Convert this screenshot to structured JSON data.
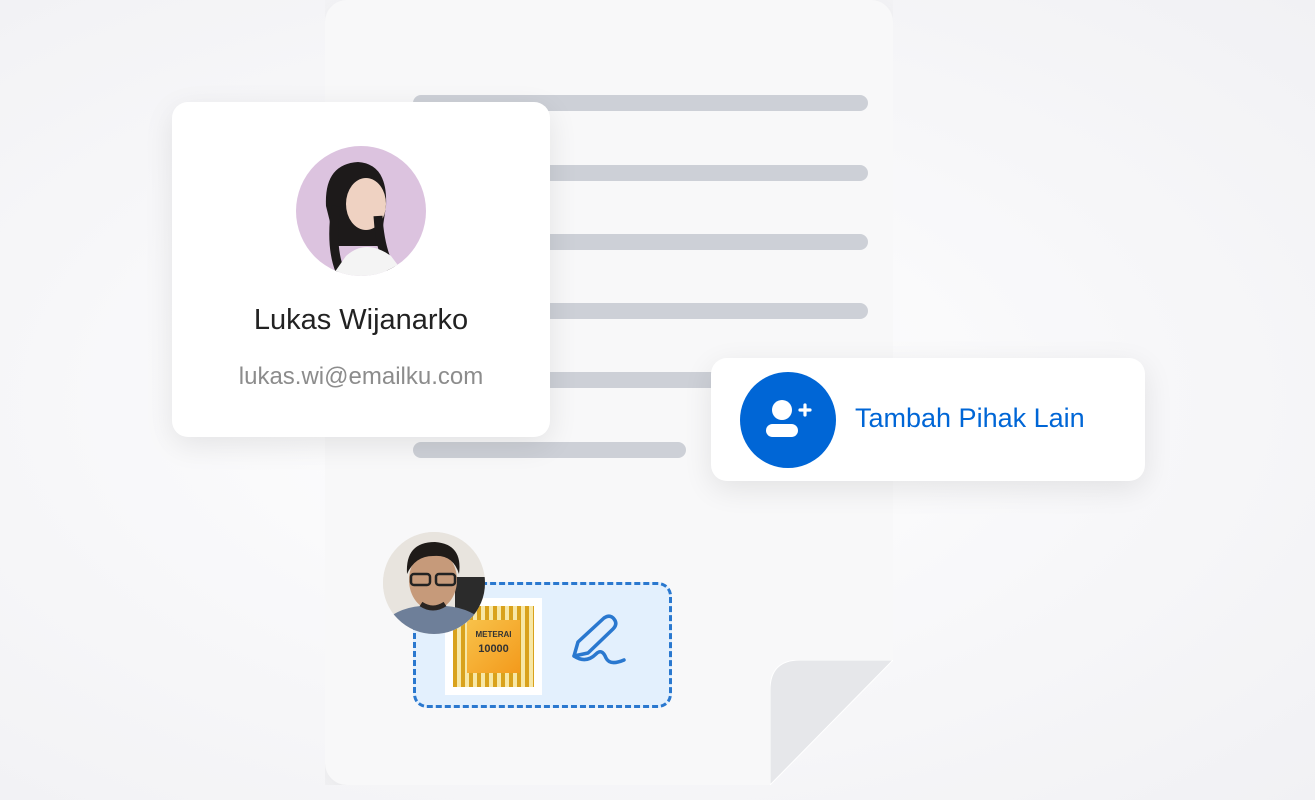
{
  "signer": {
    "name": "Lukas Wijanarko",
    "email": "lukas.wi@emailku.com"
  },
  "add_party": {
    "label": "Tambah Pihak Lain"
  },
  "stamp": {
    "title": "METERAI",
    "value": "10000"
  },
  "colors": {
    "accent": "#0066d6",
    "sig_fill": "#e3f0fd",
    "doc_line": "#cdd0d7"
  }
}
